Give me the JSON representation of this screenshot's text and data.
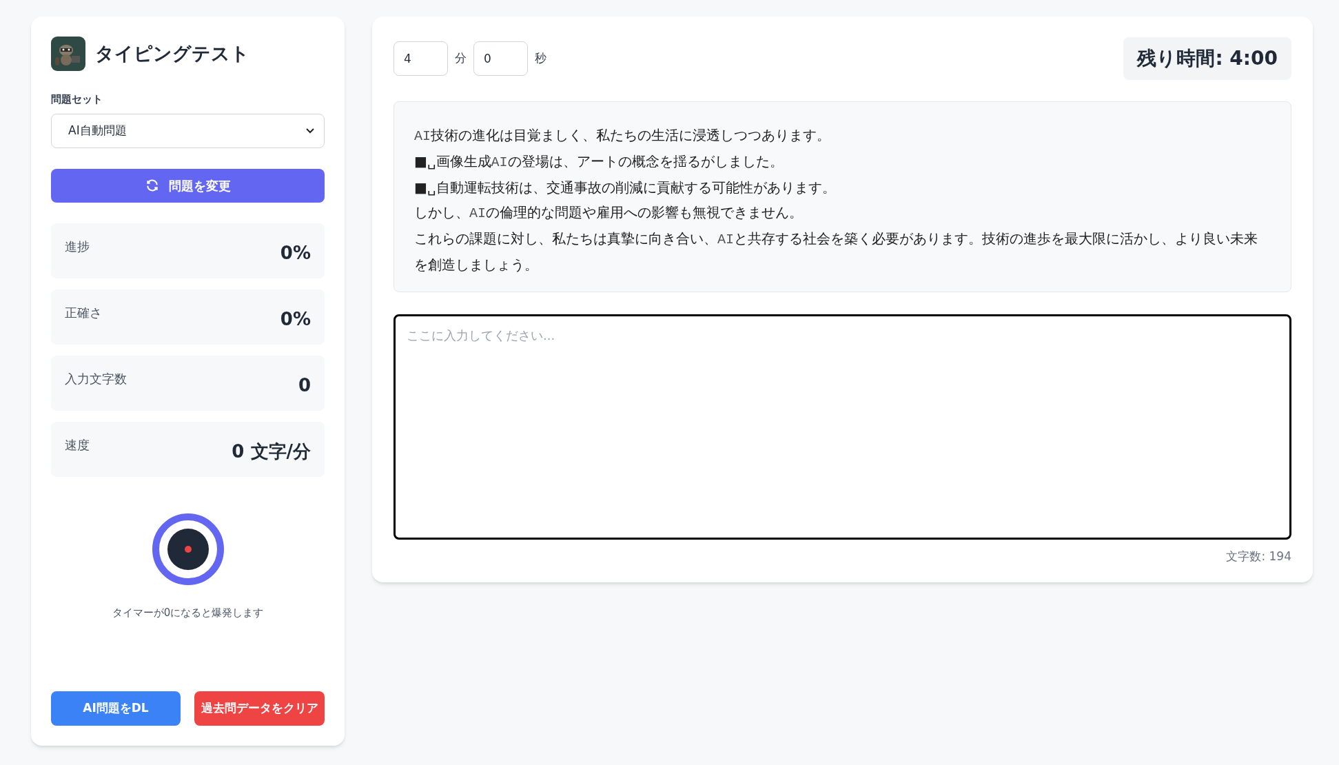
{
  "app": {
    "title": "タイピングテスト"
  },
  "problem_set": {
    "label": "問題セット",
    "value": "AI自動問題"
  },
  "change_button": "問題を変更",
  "stats": [
    {
      "label": "進捗",
      "value": "0%"
    },
    {
      "label": "正確さ",
      "value": "0%"
    },
    {
      "label": "入力文字数",
      "value": "0"
    },
    {
      "label": "速度",
      "value": "0 文字/分"
    }
  ],
  "bomb": {
    "caption": "タイマーが0になると爆発します"
  },
  "footer_buttons": [
    {
      "label": "AI問題をDL",
      "kind": "primary"
    },
    {
      "label": "過去問データをクリア",
      "kind": "danger"
    }
  ],
  "timer": {
    "minutes": "4",
    "minutes_unit": "分",
    "seconds": "0",
    "seconds_unit": "秒",
    "remaining": "残り時間: 4:00"
  },
  "passage": [
    [
      {
        "text": "AI",
        "kind": "latin"
      },
      {
        "text": "技術の進化は目覚ましく、私たちの生活に浸透しつつあります。",
        "kind": "text"
      }
    ],
    [
      {
        "text": "■␣画像生成",
        "kind": "text"
      },
      {
        "text": "AI",
        "kind": "latin"
      },
      {
        "text": "の登場は、アートの概念を揺るがしました。",
        "kind": "text"
      }
    ],
    [
      {
        "text": "■␣自動運転技術は、交通事故の削減に貢献する可能性があります。",
        "kind": "text"
      }
    ],
    [
      {
        "text": "しかし、",
        "kind": "text"
      },
      {
        "text": "AI",
        "kind": "latin"
      },
      {
        "text": "の倫理的な問題や雇用への影響も無視できません。",
        "kind": "text"
      }
    ],
    [
      {
        "text": "これらの課題に対し、私たちは真摯に向き合い、",
        "kind": "text"
      },
      {
        "text": "AI",
        "kind": "latin"
      },
      {
        "text": "と共存する社会を築く必要があります。技術の進歩を最大限に活かし、より良い未来を創造しましょう。",
        "kind": "text"
      }
    ]
  ],
  "input": {
    "placeholder": "ここに入力してください..."
  },
  "char_count": "文字数: 194"
}
